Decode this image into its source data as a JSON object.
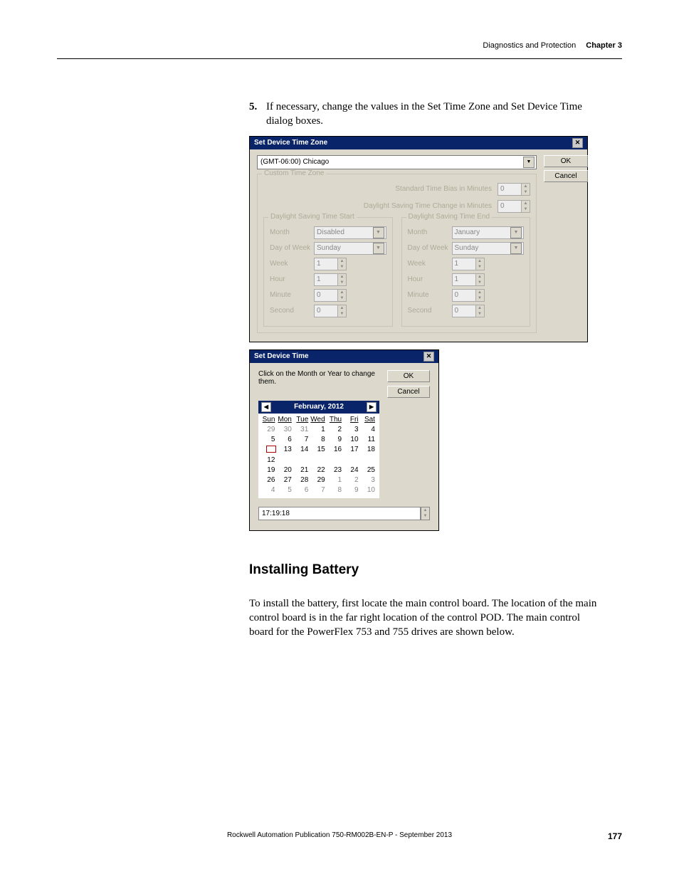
{
  "header": {
    "section": "Diagnostics and Protection",
    "chapter": "Chapter 3"
  },
  "step": {
    "number": "5.",
    "text": "If necessary, change the values in the Set Time Zone and Set Device Time dialog boxes."
  },
  "tz_dialog": {
    "title": "Set Device Time Zone",
    "close": "✕",
    "ok": "OK",
    "cancel": "Cancel",
    "select_value": "(GMT-06:00) Chicago",
    "custom_group": "Custom Time Zone",
    "std_bias_label": "Standard Time Bias in Minutes",
    "std_bias_value": "0",
    "dst_change_label": "Daylight Saving Time Change in Minutes",
    "dst_change_value": "0",
    "start_group": "Daylight Saving Time Start",
    "end_group": "Daylight Saving Time End",
    "labels": {
      "month": "Month",
      "dow": "Day of Week",
      "week": "Week",
      "hour": "Hour",
      "minute": "Minute",
      "second": "Second"
    },
    "start": {
      "month": "Disabled",
      "dow": "Sunday",
      "week": "1",
      "hour": "1",
      "minute": "0",
      "second": "0"
    },
    "end": {
      "month": "January",
      "dow": "Sunday",
      "week": "1",
      "hour": "1",
      "minute": "0",
      "second": "0"
    }
  },
  "time_dialog": {
    "title": "Set Device Time",
    "close": "✕",
    "ok": "OK",
    "cancel": "Cancel",
    "instruction": "Click on the Month or Year to change them.",
    "month_label": "February, 2012",
    "nav_prev": "◀",
    "nav_next": "▶",
    "dow": {
      "0": "Sun",
      "1": "Mon",
      "2": "Tue",
      "3": "Wed",
      "4": "Thu",
      "5": "Fri",
      "6": "Sat"
    },
    "rows": {
      "0": {
        "0": "29",
        "1": "30",
        "2": "31",
        "3": "1",
        "4": "2",
        "5": "3",
        "6": "4"
      },
      "1": {
        "0": "5",
        "1": "6",
        "2": "7",
        "3": "8",
        "4": "9",
        "5": "10",
        "6": "11"
      },
      "2": {
        "0": "12",
        "1": "13",
        "2": "14",
        "3": "15",
        "4": "16",
        "5": "17",
        "6": "18"
      },
      "3": {
        "0": "19",
        "1": "20",
        "2": "21",
        "3": "22",
        "4": "23",
        "5": "24",
        "6": "25"
      },
      "4": {
        "0": "26",
        "1": "27",
        "2": "28",
        "3": "29",
        "4": "1",
        "5": "2",
        "6": "3"
      },
      "5": {
        "0": "4",
        "1": "5",
        "2": "6",
        "3": "7",
        "4": "8",
        "5": "9",
        "6": "10"
      }
    },
    "time_value": "17:19:18"
  },
  "heading": "Installing Battery",
  "para": "To install the battery, first locate the main control board. The location of the main control board is in the far right location of the control POD. The main control board for the PowerFlex 753 and 755 drives are shown below.",
  "footer": {
    "pub": "Rockwell Automation Publication 750-RM002B-EN-P - September 2013",
    "page": "177"
  }
}
